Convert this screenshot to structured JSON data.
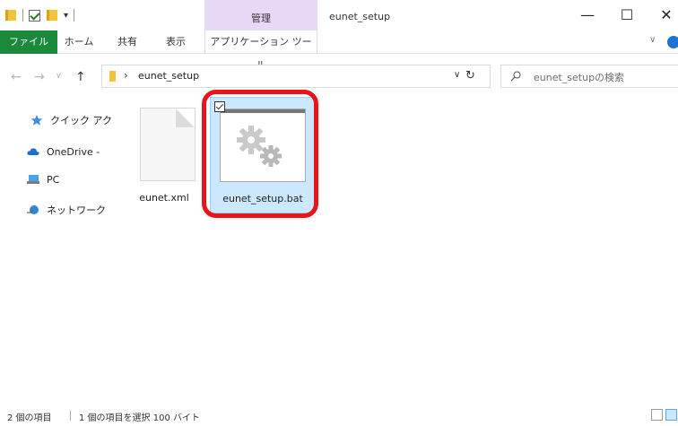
{
  "titlebar": {
    "context_tab": "管理",
    "window_title": "eunet_setup",
    "minimize": "—",
    "maximize": "☐",
    "close": "✕"
  },
  "ribbon": {
    "tabs": [
      "ファイル",
      "ホーム",
      "共有",
      "表示",
      "アプリケーション ツール"
    ]
  },
  "address": {
    "path": "eunet_setup",
    "search_placeholder": "eunet_setupの検索"
  },
  "navpane": {
    "items": [
      {
        "label": "クイック アク",
        "icon": "star-icon"
      },
      {
        "label": "OneDrive -",
        "icon": "cloud-icon"
      },
      {
        "label": "PC",
        "icon": "pc-icon"
      },
      {
        "label": "ネットワーク",
        "icon": "network-icon"
      }
    ]
  },
  "files": [
    {
      "name": "eunet.xml",
      "icon": "xml-file-icon",
      "selected": false
    },
    {
      "name": "eunet_setup.bat",
      "icon": "batch-file-icon",
      "selected": true
    }
  ],
  "status": {
    "item_count": "2 個の項目",
    "selection": "1 個の項目を選択 100 バイト"
  },
  "colors": {
    "file_tab": "#1a8a3a",
    "context_tab": "#e8d9f7",
    "selection": "#cce8ff",
    "highlight_ring": "#e8141c"
  }
}
